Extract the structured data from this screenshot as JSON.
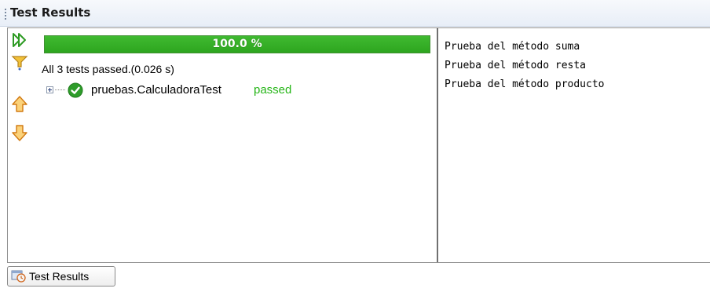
{
  "panel": {
    "title": "Test Results",
    "progress_value": 1.0,
    "progress_label": "100.0 %",
    "summary": "All 3 tests passed.(0.026 s)",
    "tests": [
      {
        "name": "pruebas.CalculadoraTest",
        "status": "passed"
      }
    ],
    "toolbar": [
      {
        "icon": "rerun-icon"
      },
      {
        "icon": "filter-icon"
      },
      {
        "icon": "previous-failure-icon"
      },
      {
        "icon": "next-failure-icon"
      }
    ]
  },
  "output": {
    "lines": [
      "Prueba del método suma",
      "Prueba del método resta",
      "Prueba del método producto"
    ]
  },
  "bottom_tab": {
    "label": "Test Results",
    "icon": "test-results-icon"
  },
  "colors": {
    "progress_green": "#2ea51f",
    "passed_text": "#25b517",
    "check_green": "#2e9c2a"
  }
}
